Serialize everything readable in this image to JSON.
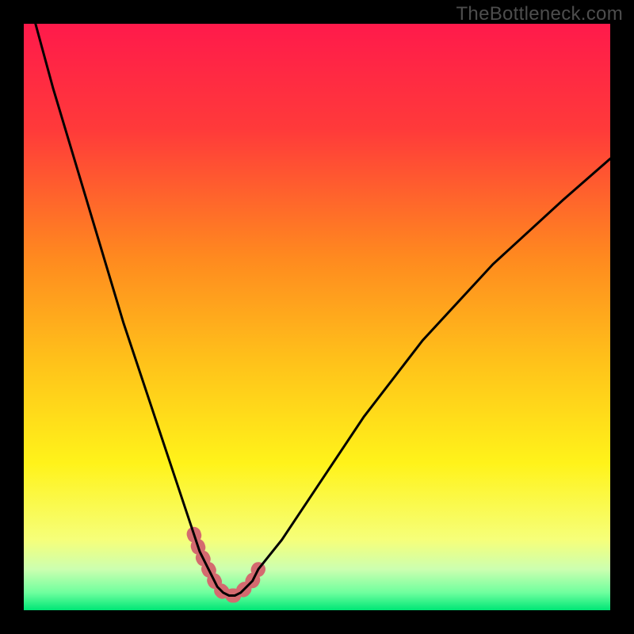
{
  "watermark": "TheBottleneck.com",
  "colors": {
    "frame": "#000000",
    "gradient_stops": [
      {
        "offset": 0.0,
        "color": "#ff1a4b"
      },
      {
        "offset": 0.18,
        "color": "#ff3a3a"
      },
      {
        "offset": 0.4,
        "color": "#ff8a1f"
      },
      {
        "offset": 0.58,
        "color": "#ffc31a"
      },
      {
        "offset": 0.75,
        "color": "#fff31a"
      },
      {
        "offset": 0.88,
        "color": "#f6ff7a"
      },
      {
        "offset": 0.93,
        "color": "#ccffb0"
      },
      {
        "offset": 0.97,
        "color": "#6fff9e"
      },
      {
        "offset": 1.0,
        "color": "#00e676"
      }
    ],
    "curve": "#000000",
    "highlight": "#d46a6f"
  },
  "chart_data": {
    "type": "line",
    "title": "",
    "xlabel": "",
    "ylabel": "",
    "xlim": [
      0,
      100
    ],
    "ylim": [
      0,
      100
    ],
    "series": [
      {
        "name": "bottleneck-curve",
        "x": [
          2,
          5,
          8,
          11,
          14,
          17,
          20,
          23,
          26,
          29,
          30,
          31,
          32,
          33,
          34,
          35,
          36,
          37,
          38,
          39,
          40,
          44,
          50,
          58,
          68,
          80,
          92,
          100
        ],
        "values": [
          100,
          89,
          79,
          69,
          59,
          49,
          40,
          31,
          22,
          13,
          10,
          8,
          6,
          4,
          3,
          2.5,
          2.5,
          3,
          4,
          5,
          7,
          12,
          21,
          33,
          46,
          59,
          70,
          77
        ]
      }
    ],
    "highlight_band": {
      "x": [
        29.0,
        30.0,
        31.0,
        32.0,
        33.0,
        34.0,
        35.0,
        36.0,
        37.0,
        38.0,
        39.0,
        40.0
      ],
      "values": [
        13.0,
        10.0,
        8.0,
        6.0,
        4.0,
        3.0,
        2.5,
        2.5,
        3.0,
        4.0,
        5.0,
        7.0
      ]
    }
  }
}
